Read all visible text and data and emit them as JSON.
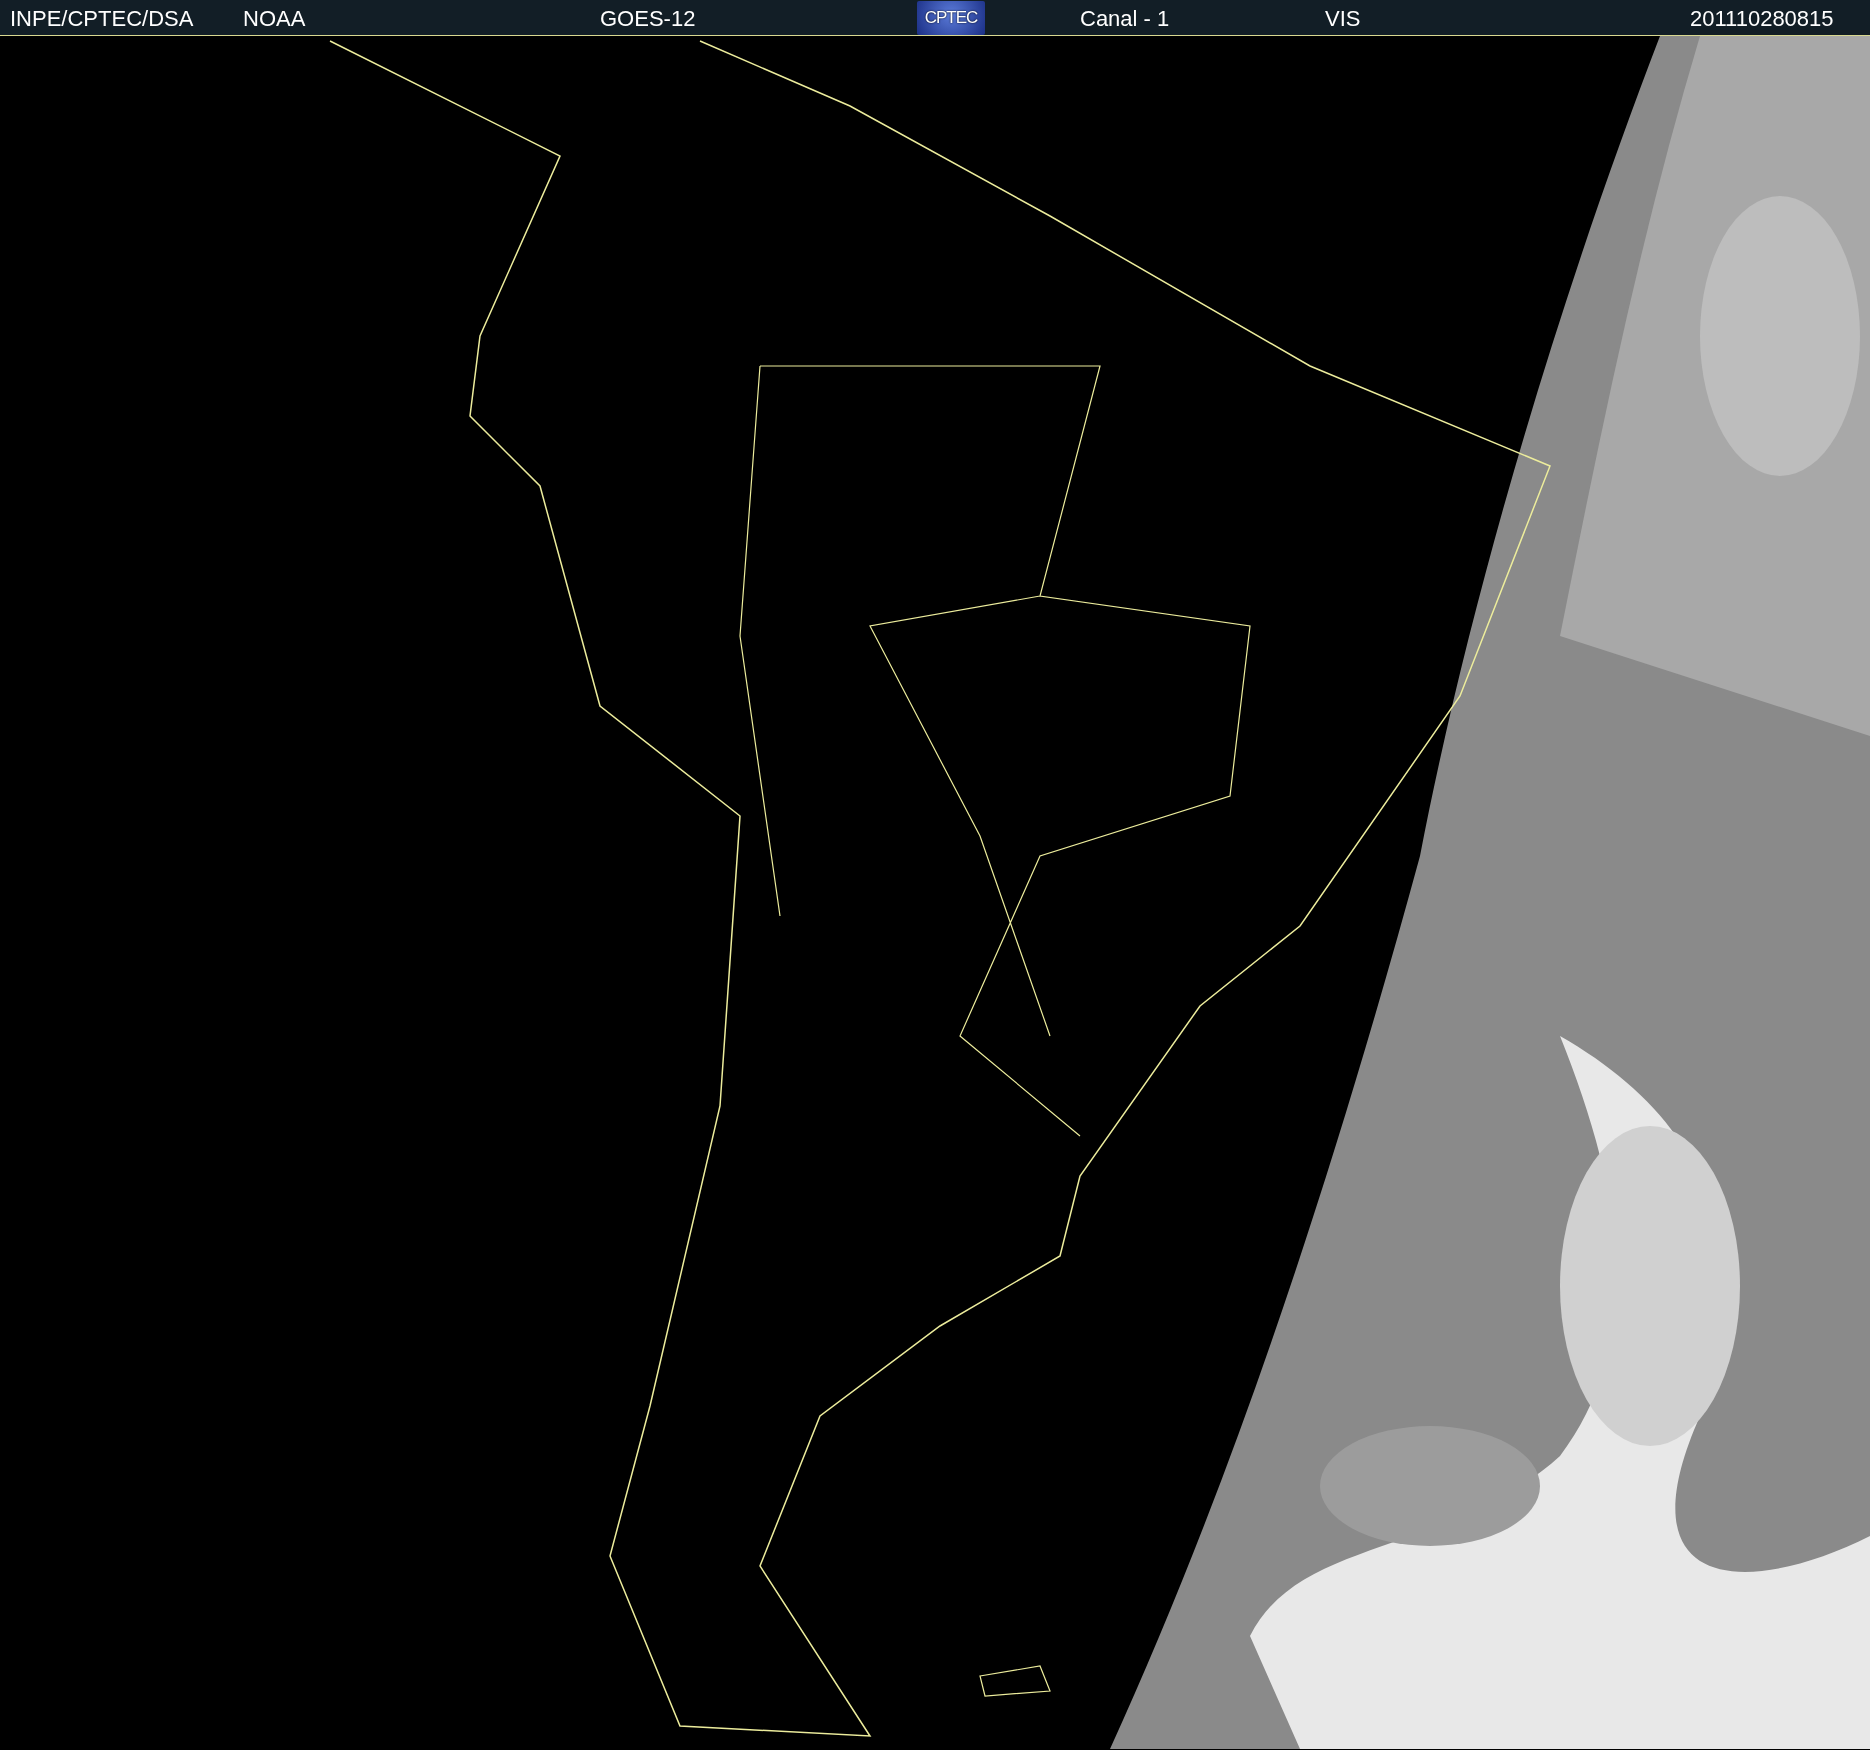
{
  "header": {
    "items": [
      {
        "kind": "text",
        "text": "INPE/CPTEC/DSA"
      },
      {
        "kind": "text",
        "text": "NOAA"
      },
      {
        "kind": "text",
        "text": "GOES-12"
      },
      {
        "kind": "logo",
        "text": "CPTEC"
      },
      {
        "kind": "text",
        "text": "Canal - 1"
      },
      {
        "kind": "text",
        "text": "VIS"
      },
      {
        "kind": "text",
        "text": "201110280815"
      }
    ]
  }
}
